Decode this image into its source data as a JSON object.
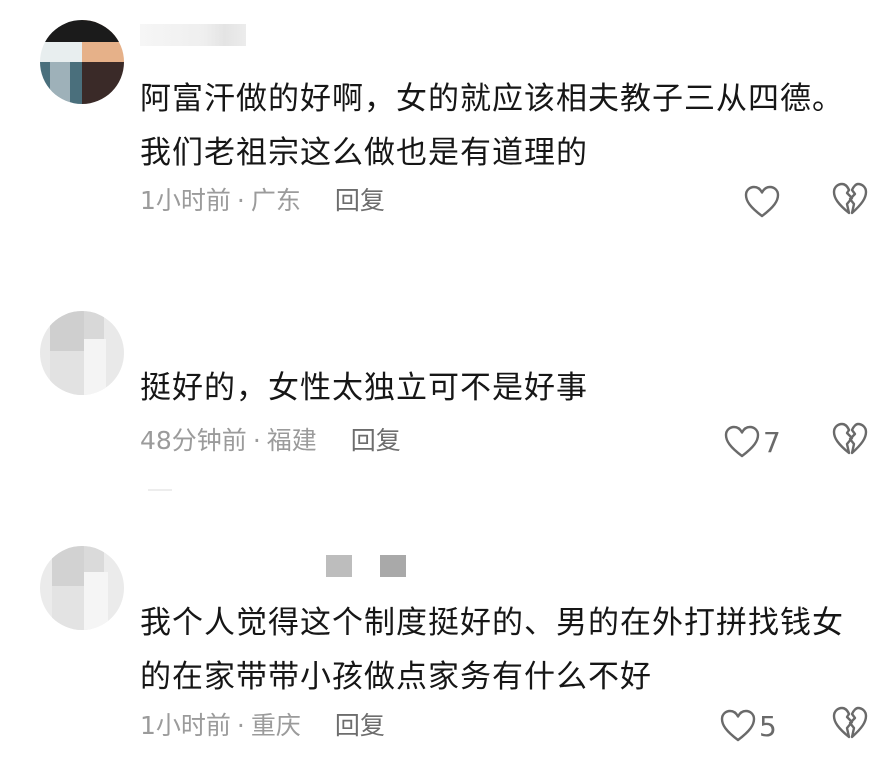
{
  "comments": [
    {
      "text_lines": [
        "阿富汗做的好啊，女的就应该相夫教子三从四德。",
        "我们老祖宗这么做也是有道理的"
      ],
      "time": "1小时前",
      "separator": "·",
      "location": "广东",
      "reply_label": "回复",
      "like_count": ""
    },
    {
      "text_lines": [
        "挺好的，女性太独立可不是好事"
      ],
      "time": "48分钟前",
      "separator": "·",
      "location": "福建",
      "reply_label": "回复",
      "like_count": "7"
    },
    {
      "text_lines": [
        "我个人觉得这个制度挺好的、男的在外打拼找钱女",
        "的在家带带小孩做点家务有什么不好"
      ],
      "time": "1小时前",
      "separator": "·",
      "location": "重庆",
      "reply_label": "回复",
      "like_count": "5"
    }
  ],
  "colors": {
    "text": "#161616",
    "meta": "#9b9b9b",
    "icon": "#6a6a6a"
  },
  "icons": {
    "like": "heart-outline-icon",
    "dislike": "broken-heart-icon"
  }
}
